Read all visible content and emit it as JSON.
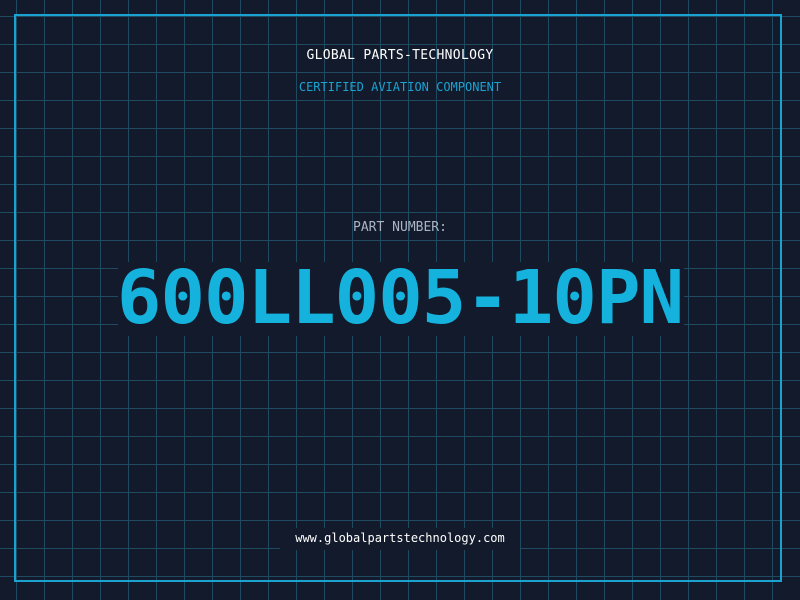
{
  "label": {
    "company": "GLOBAL PARTS-TECHNOLOGY",
    "subtitle": "CERTIFIED AVIATION COMPONENT",
    "part_label": "PART NUMBER:",
    "part_number": "600LL005-10PN",
    "website": "www.globalpartstechnology.com"
  },
  "colors": {
    "background": "#121a2c",
    "grid": "#1f4a62",
    "accent": "#14b2dc",
    "frame": "#1aa3d1"
  }
}
